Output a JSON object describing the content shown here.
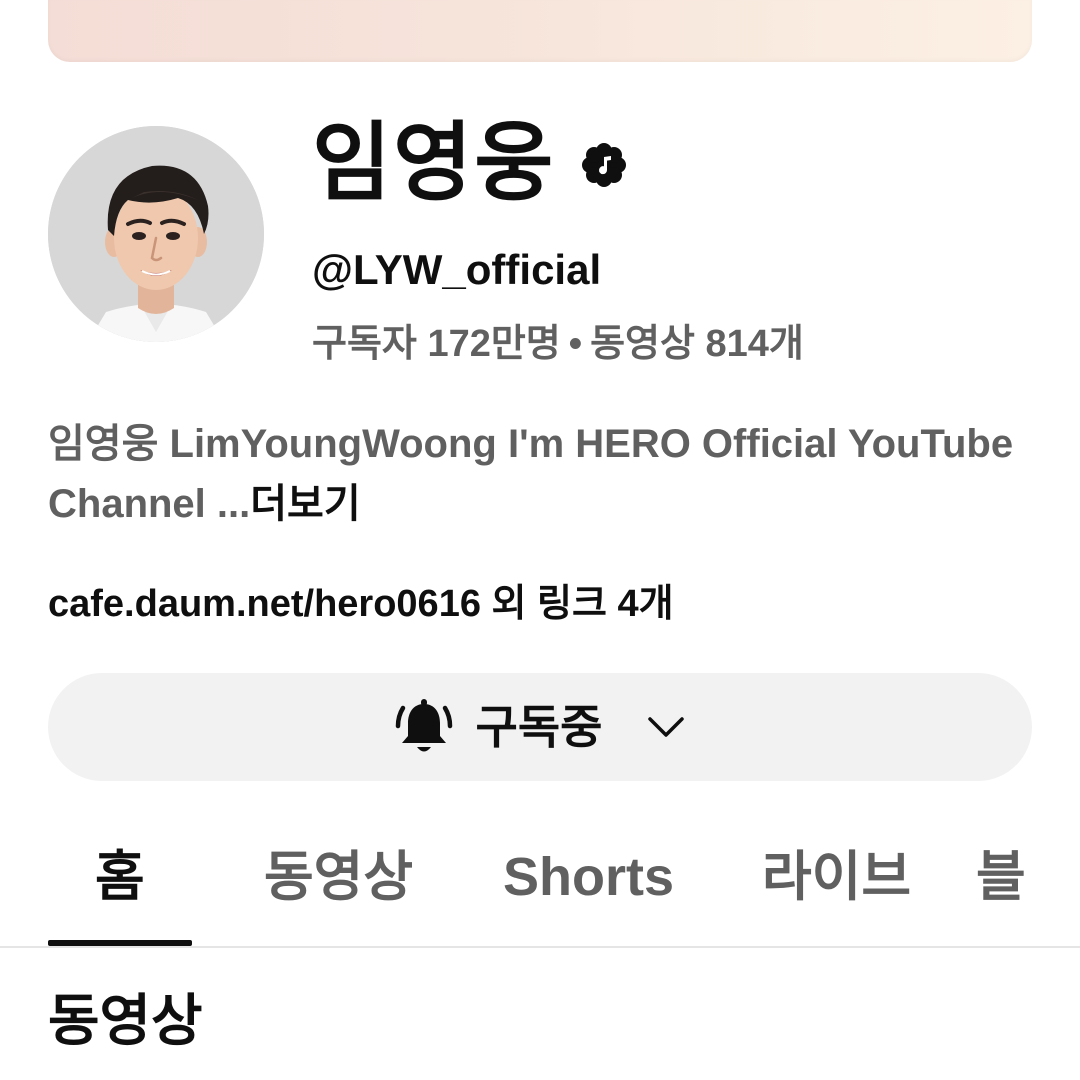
{
  "channel": {
    "name": "임영웅",
    "handle": "@LYW_official",
    "subscribers": "구독자 172만명",
    "separator": "•",
    "videos": "동영상 814개",
    "description": "임영웅 LimYoungWoong I'm HERO Official YouTube Channel ...",
    "more_label": "더보기",
    "links": "cafe.daum.net/hero0616 외 링크 4개",
    "verified_icon": "verified-badge-icon"
  },
  "subscribe": {
    "label": "구독중",
    "bell_icon": "bell-icon",
    "dropdown_icon": "chevron-down-icon"
  },
  "tabs": [
    {
      "label": "홈",
      "active": true
    },
    {
      "label": "동영상",
      "active": false
    },
    {
      "label": "Shorts",
      "active": false
    },
    {
      "label": "라이브",
      "active": false
    },
    {
      "label": "블",
      "active": false
    }
  ],
  "section": {
    "title": "동영상"
  },
  "colors": {
    "primary_text": "#0f0f0f",
    "secondary_text": "#606060",
    "button_bg": "#f2f2f2",
    "banner_start": "#f4ddd6",
    "banner_end": "#fcefe3"
  }
}
